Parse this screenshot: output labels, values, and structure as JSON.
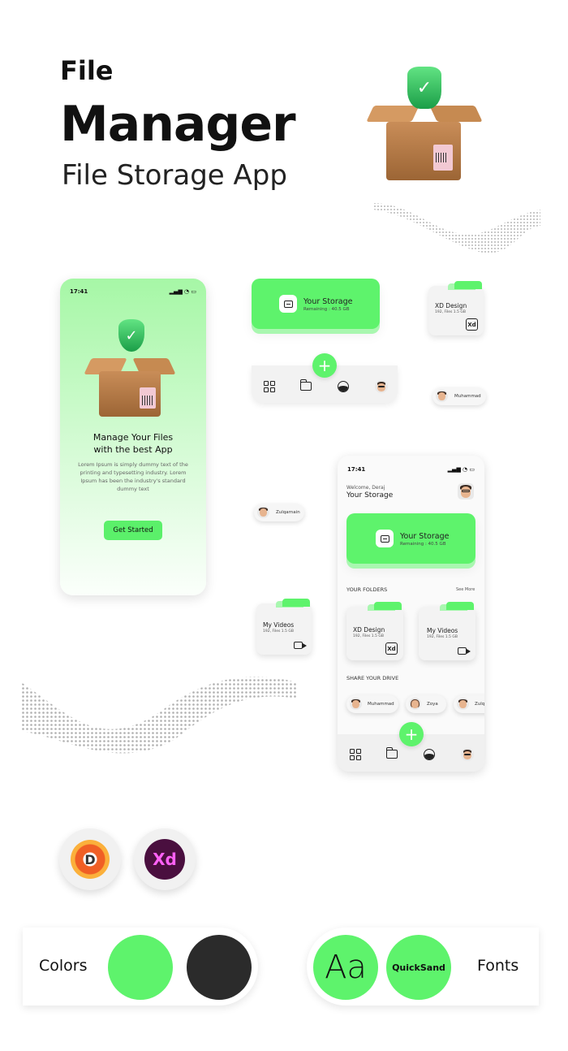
{
  "header": {
    "line1": "File",
    "line2": "Manager",
    "line3": "File Storage App"
  },
  "colors": {
    "accent": "#5EF36C",
    "dark": "#2B2B2B"
  },
  "phone1": {
    "time": "17:41",
    "title": "Manage Your Files\nwith the best App",
    "body": "Lorem Ipsum is simply dummy text of the printing and typesetting industry. Lorem Ipsum has been the industry's standard dummy text",
    "cta": "Get Started"
  },
  "storage_card": {
    "title": "Your Storage",
    "subtitle": "Remaining : 40.5 GB"
  },
  "folders": {
    "xd": {
      "title": "XD Design",
      "subtitle": "192, Files 1.5 GB",
      "icon": "Xd"
    },
    "videos": {
      "title": "My Videos",
      "subtitle": "192, Files 1.5 GB"
    }
  },
  "chips": {
    "muhammad": "Muhammad",
    "zulqarnain": "Zulqarnain",
    "zoya": "Zoya"
  },
  "phone2": {
    "time": "17:41",
    "welcome": "Welcome, Deraj",
    "heading": "Your Storage",
    "section_folders": "YOUR FOLDERS",
    "see_more": "See More",
    "section_share": "SHARE YOUR DRIVE"
  },
  "tools": {
    "xd": "Xd",
    "dribbble": "D"
  },
  "bottom": {
    "colors_label": "Colors",
    "font_sample": "Aa",
    "font_name": "QuickSand",
    "fonts_label": "Fonts"
  }
}
